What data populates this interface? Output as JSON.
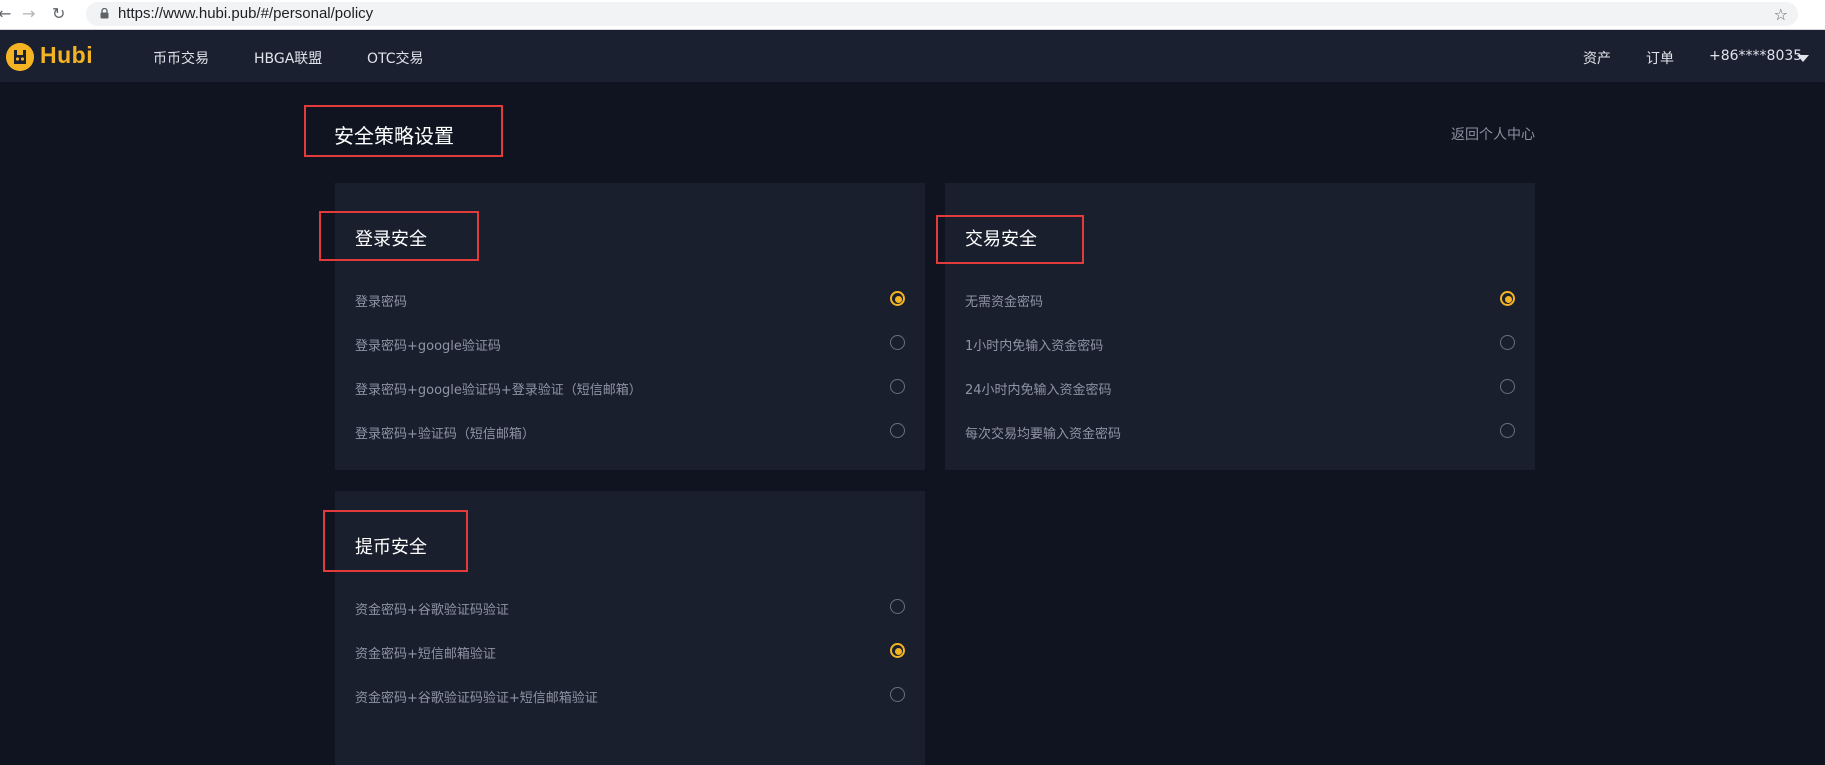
{
  "browser": {
    "url": "https://www.hubi.pub/#/personal/policy",
    "back_icon": "back-arrow",
    "forward_icon": "forward-arrow",
    "reload_icon": "reload",
    "bookmark_icon": "star"
  },
  "header": {
    "brand": "Hubi",
    "brand_color": "#f4b322",
    "nav": [
      {
        "label": "币币交易"
      },
      {
        "label": "HBGA联盟"
      },
      {
        "label": "OTC交易"
      }
    ],
    "right_links": [
      {
        "label": "资产"
      },
      {
        "label": "订单"
      }
    ],
    "account": "+86****8035"
  },
  "page": {
    "title": "安全策略设置",
    "back_link": "返回个人中心"
  },
  "login_security": {
    "title": "登录安全",
    "options": [
      {
        "label": "登录密码",
        "selected": true
      },
      {
        "label": "登录密码+google验证码",
        "selected": false
      },
      {
        "label": "登录密码+google验证码+登录验证（短信邮箱）",
        "selected": false
      },
      {
        "label": "登录密码+验证码（短信邮箱）",
        "selected": false
      }
    ]
  },
  "trade_security": {
    "title": "交易安全",
    "options": [
      {
        "label": "无需资金密码",
        "selected": true
      },
      {
        "label": "1小时内免输入资金密码",
        "selected": false
      },
      {
        "label": "24小时内免输入资金密码",
        "selected": false
      },
      {
        "label": "每次交易均要输入资金密码",
        "selected": false
      }
    ]
  },
  "withdraw_security": {
    "title": "提币安全",
    "options": [
      {
        "label": "资金密码+谷歌验证码验证",
        "selected": false
      },
      {
        "label": "资金密码+短信邮箱验证",
        "selected": true
      },
      {
        "label": "资金密码+谷歌验证码验证+短信邮箱验证",
        "selected": false
      }
    ]
  },
  "colors": {
    "accent": "#f4b322",
    "annotation": "#e23b3b",
    "background": "#0f1420",
    "card": "#1a1f2e"
  }
}
